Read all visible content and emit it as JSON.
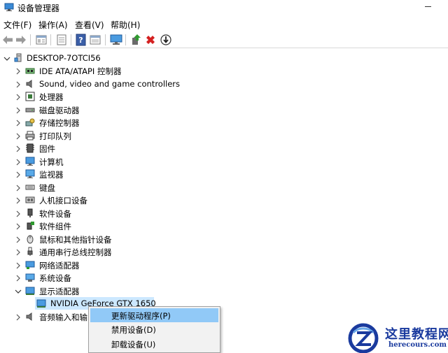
{
  "window": {
    "title": "设备管理器"
  },
  "menubar": {
    "items": [
      "文件(F)",
      "操作(A)",
      "查看(V)",
      "帮助(H)"
    ]
  },
  "toolbar": {
    "buttons": [
      "back-arrow-icon",
      "forward-arrow-icon",
      "properties-icon",
      "view-icon",
      "help-icon",
      "show-hidden-icon",
      "monitor-icon",
      "update-driver-icon",
      "uninstall-icon",
      "enable-icon"
    ],
    "accent_green": "#2e9a2e",
    "accent_red": "#d42020"
  },
  "tree": {
    "root": "DESKTOP-7OTCI56",
    "categories": [
      "IDE ATA/ATAPI 控制器",
      "Sound, video and game controllers",
      "处理器",
      "磁盘驱动器",
      "存储控制器",
      "打印队列",
      "固件",
      "计算机",
      "监视器",
      "键盘",
      "人机接口设备",
      "软件设备",
      "软件组件",
      "鼠标和其他指针设备",
      "通用串行总线控制器",
      "网络适配器",
      "系统设备",
      "显示适配器"
    ],
    "expanded_category": "显示适配器",
    "device": "NVIDIA GeForce GTX 1650",
    "after_category": "音频输入和输出"
  },
  "context_menu": {
    "items": [
      "更新驱动程序(P)",
      "禁用设备(D)",
      "卸载设备(U)"
    ],
    "highlight_color": "#91c9f7"
  },
  "watermark": {
    "title": "这里教程网",
    "url": "herecours.com",
    "color": "#1a3a9e"
  }
}
